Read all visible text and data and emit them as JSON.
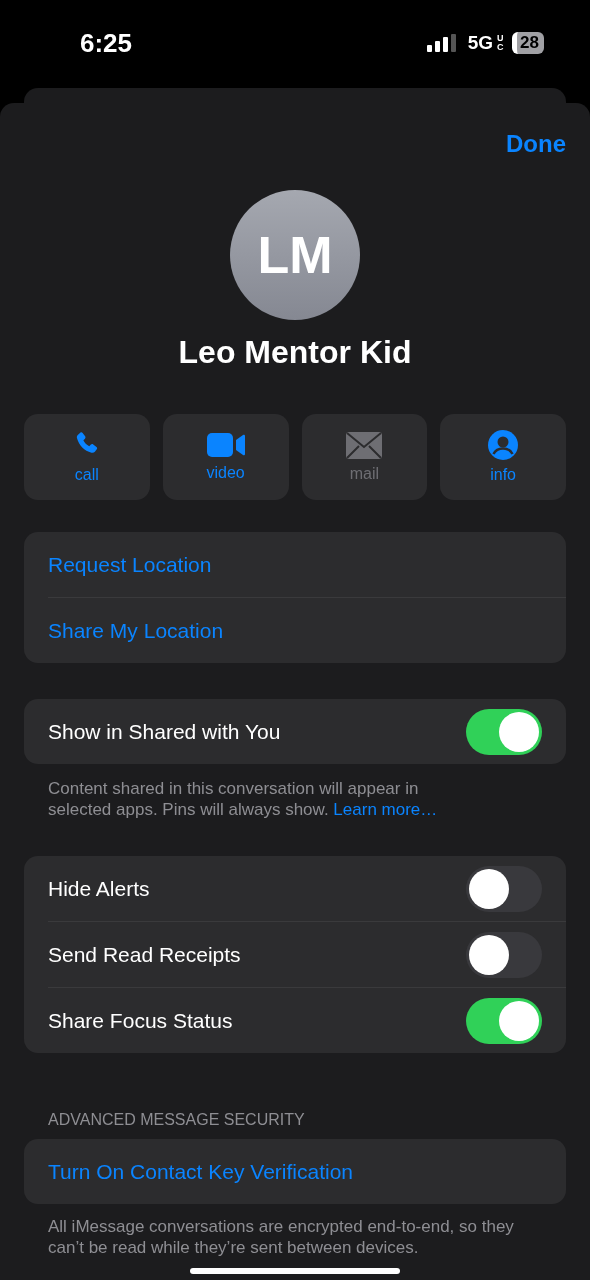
{
  "status_bar": {
    "time": "6:25",
    "network": "5G",
    "network_sub": "UC",
    "battery": "28"
  },
  "done_button": "Done",
  "contact": {
    "initials": "LM",
    "name": "Leo Mentor Kid"
  },
  "actions": [
    {
      "kind": "call",
      "label": "call",
      "disabled": false
    },
    {
      "kind": "video",
      "label": "video",
      "disabled": false
    },
    {
      "kind": "mail",
      "label": "mail",
      "disabled": true
    },
    {
      "kind": "info",
      "label": "info",
      "disabled": false
    }
  ],
  "location_links": [
    "Request Location",
    "Share My Location"
  ],
  "shared_with_you": {
    "label": "Show in Shared with You",
    "on": true
  },
  "shared_note": {
    "text": "Content shared in this conversation will appear in selected apps. Pins will always show.",
    "link": "Learn more…"
  },
  "settings": [
    {
      "label": "Hide Alerts",
      "on": false
    },
    {
      "label": "Send Read Receipts",
      "on": false
    },
    {
      "label": "Share Focus Status",
      "on": true
    }
  ],
  "security": {
    "header": "ADVANCED MESSAGE SECURITY",
    "link": "Turn On Contact Key Verification",
    "note": "All iMessage conversations are encrypted end-to-end, so they can’t be read while they’re sent between devices."
  }
}
